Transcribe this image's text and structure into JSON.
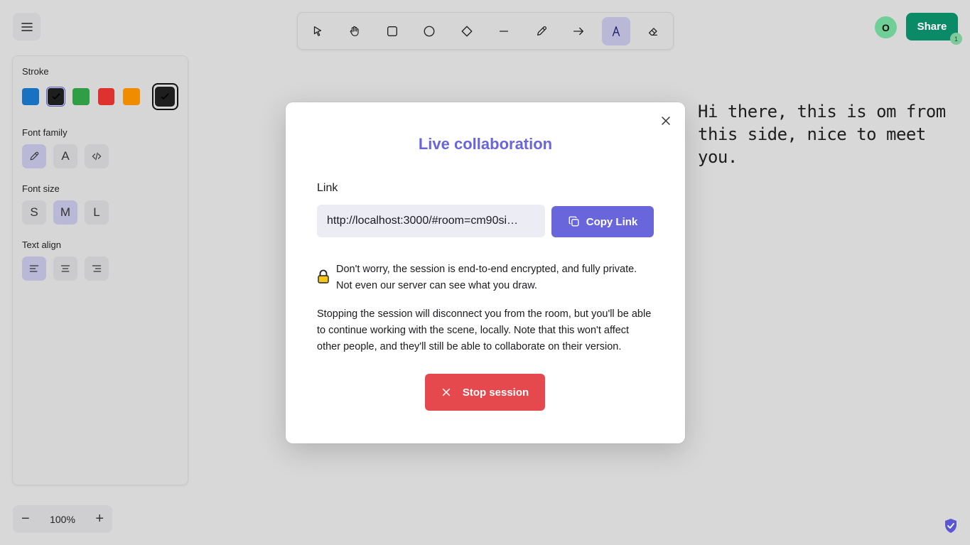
{
  "toolbar": {
    "tools": [
      "selection-tool",
      "hand-tool",
      "rectangle-tool",
      "ellipse-tool",
      "diamond-tool",
      "line-tool",
      "draw-tool",
      "arrow-tool",
      "text-tool",
      "eraser-tool"
    ],
    "active_tool": "text-tool"
  },
  "header": {
    "avatar_initial": "O",
    "share_label": "Share",
    "share_badge": "1"
  },
  "panel": {
    "stroke_label": "Stroke",
    "stroke_colors": [
      "#1971c2",
      "#1e1e1e",
      "#2f9e44",
      "#e03131",
      "#f08c00"
    ],
    "stroke_current": "#1e1e1e",
    "font_family_label": "Font family",
    "font_family_options": [
      "hand-drawn",
      "normal",
      "code"
    ],
    "font_family_normal_glyph": "A",
    "font_size_label": "Font size",
    "font_sizes": [
      "S",
      "M",
      "L"
    ],
    "font_size_active": "M",
    "text_align_label": "Text align",
    "text_align_active": "left"
  },
  "zoom": {
    "value": "100%"
  },
  "canvas_text": "Hi there, this is om from this side, nice to meet you.",
  "modal": {
    "title": "Live collaboration",
    "link_label": "Link",
    "link_value": "http://localhost:3000/#room=cm90si…",
    "copy_label": "Copy Link",
    "note": "Don't worry, the session is end-to-end encrypted, and fully private. Not even our server can see what you draw.",
    "stop_description": "Stopping the session will disconnect you from the room, but you'll be able to continue working with the scene, locally. Note that this won't affect other people, and they'll still be able to collaborate on their version.",
    "stop_label": "Stop session"
  },
  "colors": {
    "accent": "#6965db",
    "share": "#0b8a67",
    "danger": "#e5484d"
  }
}
